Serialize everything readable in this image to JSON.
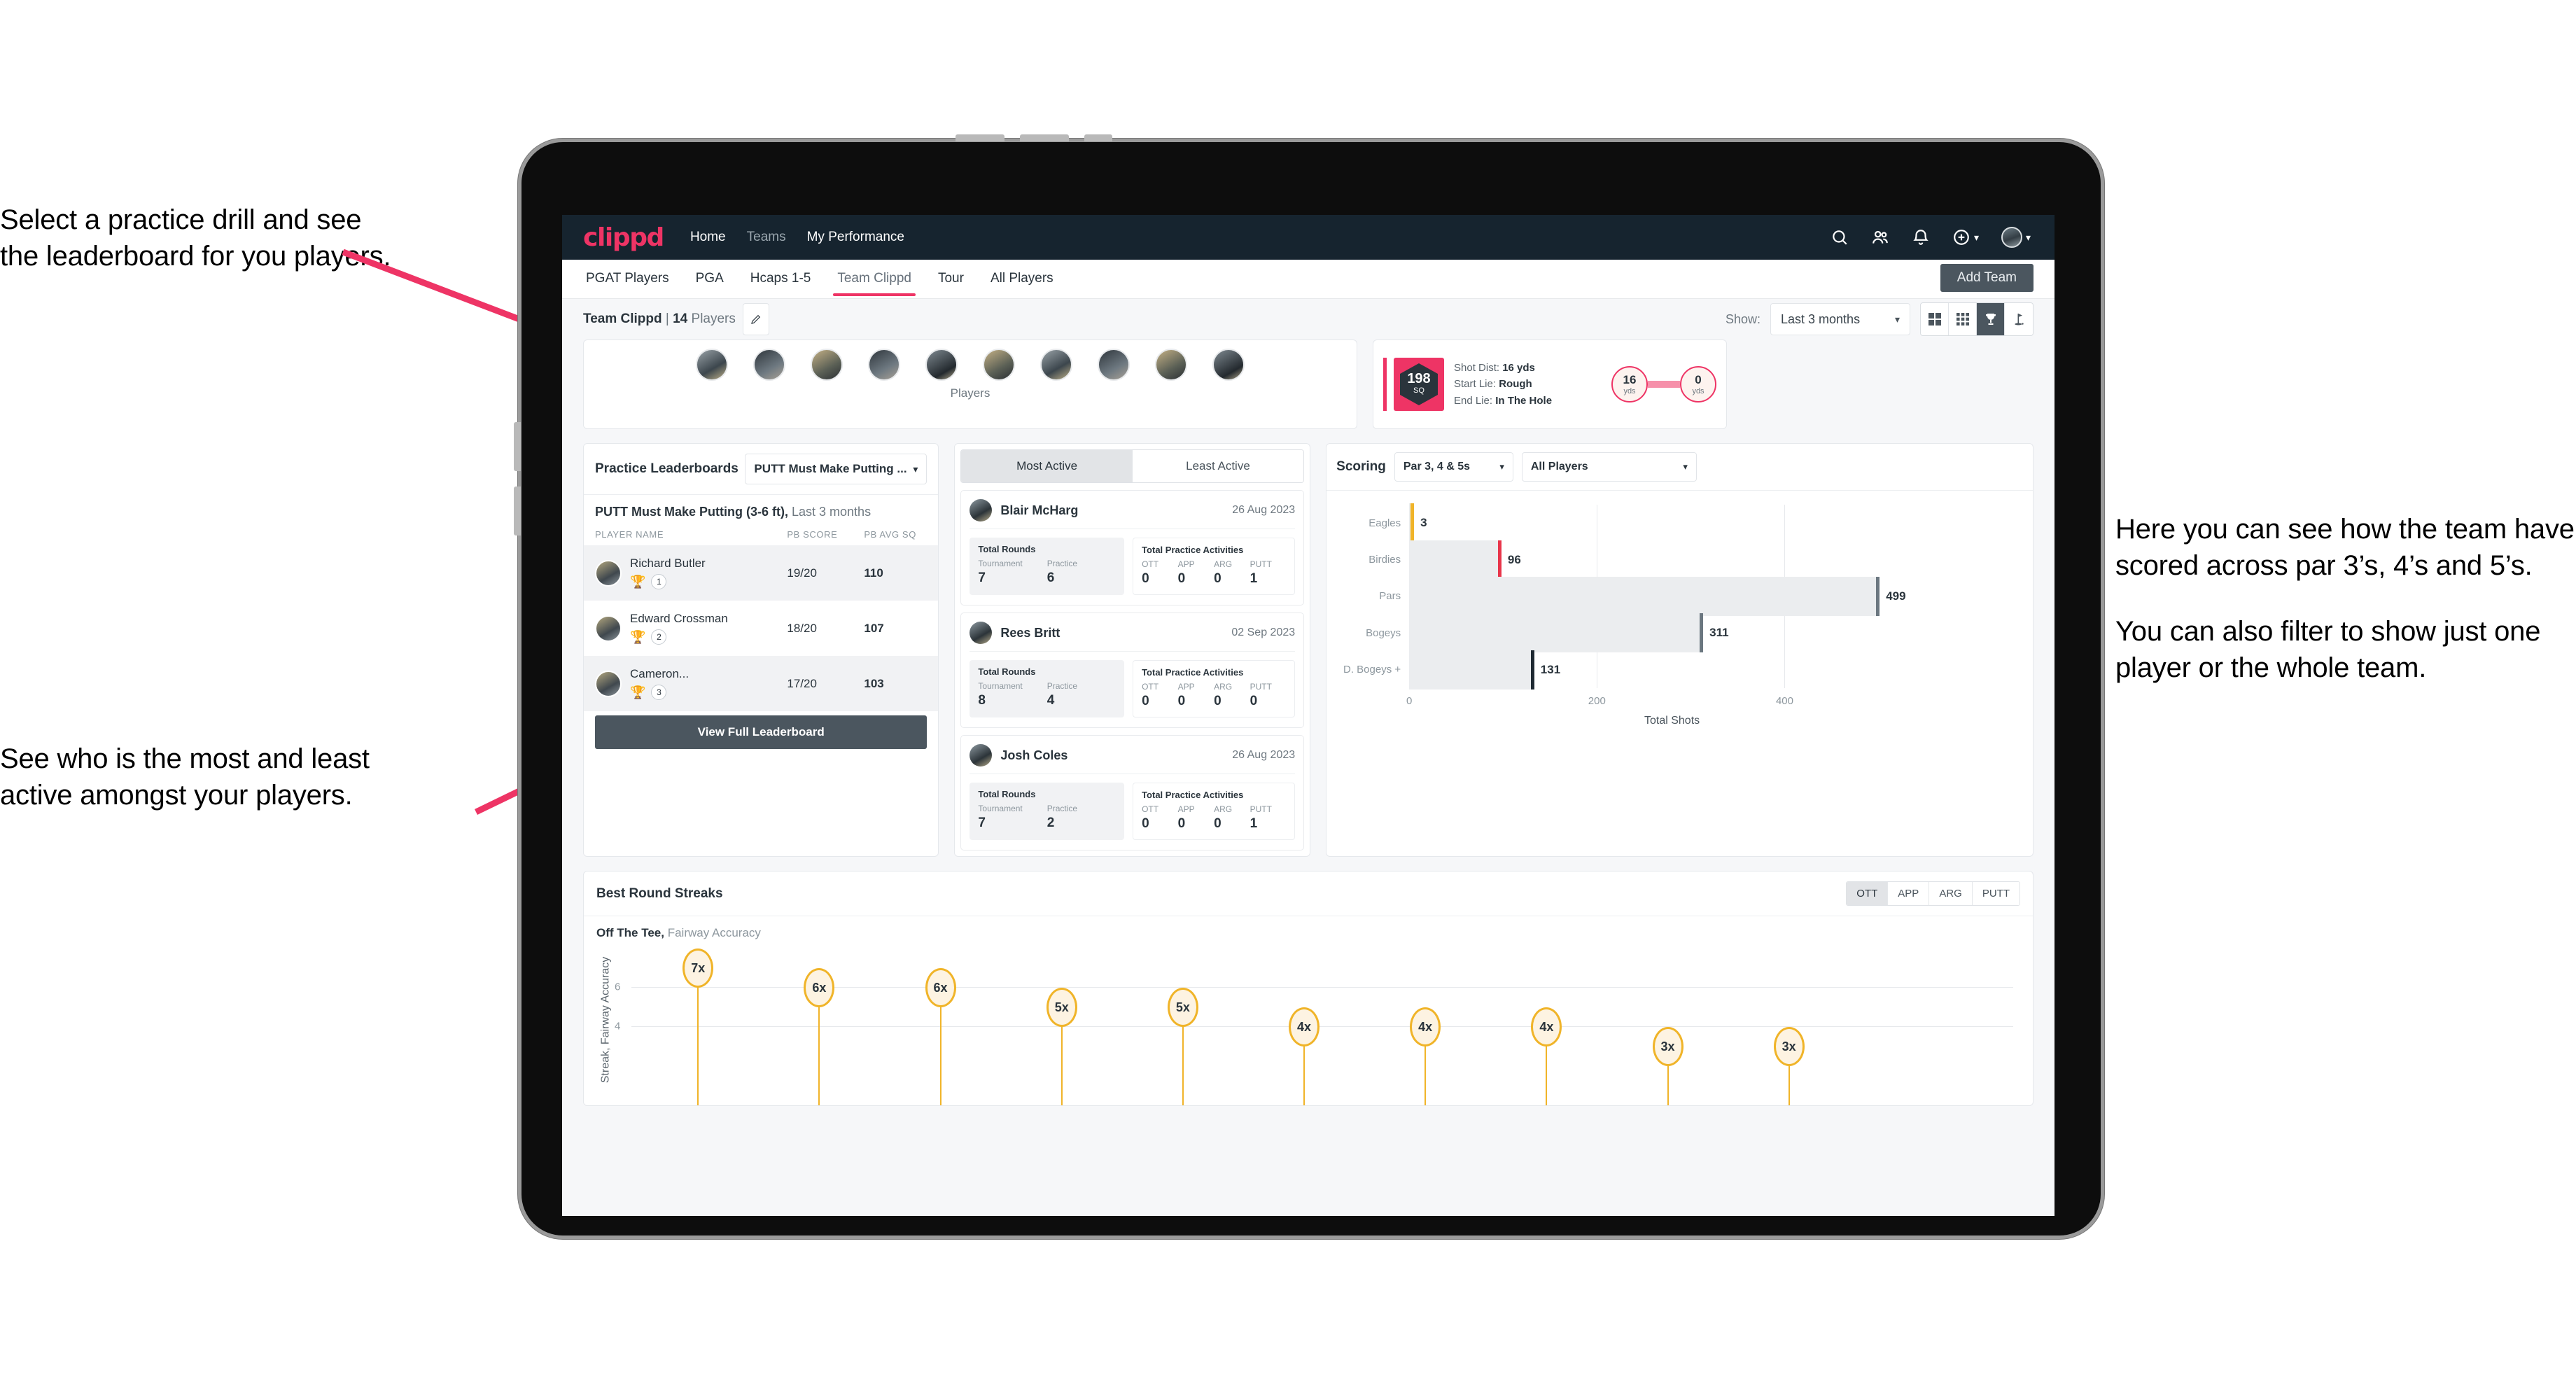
{
  "annotations": {
    "top_left": [
      "Select a practice drill and see",
      "the leaderboard for you players."
    ],
    "mid_left": [
      "See who is the most and least",
      "active amongst your players."
    ],
    "right": [
      "Here you can see how the team have scored across par 3’s, 4’s and 5’s.",
      "You can also filter to show just one player or the whole team."
    ]
  },
  "navbar": {
    "brand": "clippd",
    "links": [
      {
        "label": "Home",
        "dim": false
      },
      {
        "label": "Teams",
        "dim": true
      },
      {
        "label": "My Performance",
        "dim": false
      }
    ],
    "icons": [
      "search-icon",
      "people-icon",
      "bell-icon",
      "plus-circle-icon",
      "avatar"
    ]
  },
  "tabs": [
    {
      "label": "PGAT Players",
      "active": false
    },
    {
      "label": "PGA",
      "active": false
    },
    {
      "label": "Hcaps 1-5",
      "active": false
    },
    {
      "label": "Team Clippd",
      "active": true
    },
    {
      "label": "Tour",
      "active": false
    },
    {
      "label": "All Players",
      "active": false
    }
  ],
  "add_team_button": "Add Team",
  "subbar": {
    "team_name": "Team Clippd",
    "separator": " | ",
    "player_count": "14",
    "players_word": " Players",
    "edit_icon": "pencil-icon",
    "show_label": "Show:",
    "range_value": "Last 3 months",
    "view_toggles": [
      "grid-2x2-icon",
      "grid-3x3-icon",
      "trophy-icon",
      "flag-icon"
    ],
    "active_view": "trophy-icon"
  },
  "players_strip": {
    "caption": "Players",
    "avatar_count": 10
  },
  "shot_card": {
    "sq_value": "198",
    "sq_unit": "SQ",
    "lines": [
      {
        "label": "Shot Dist: ",
        "value": "16 yds"
      },
      {
        "label": "Start Lie: ",
        "value": "Rough"
      },
      {
        "label": "End Lie: ",
        "value": "In The Hole"
      }
    ],
    "start_node": {
      "value": "16",
      "unit": "yds"
    },
    "end_node": {
      "value": "0",
      "unit": "yds"
    }
  },
  "leaderboard": {
    "title": "Practice Leaderboards",
    "drill_select": "PUTT Must Make Putting ...",
    "subtitle_bold": "PUTT Must Make Putting (3-6 ft),",
    "subtitle_light": " Last 3 months",
    "columns": [
      "PLAYER NAME",
      "PB SCORE",
      "PB AVG SQ"
    ],
    "rows": [
      {
        "name": "Richard Butler",
        "rank": "1",
        "medal": "gold",
        "score": "19/20",
        "sq": "110"
      },
      {
        "name": "Edward Crossman",
        "rank": "2",
        "medal": "silver",
        "score": "18/20",
        "sq": "107"
      },
      {
        "name": "Cameron...",
        "rank": "3",
        "medal": "bronze",
        "score": "17/20",
        "sq": "103"
      }
    ],
    "button": "View Full Leaderboard"
  },
  "activity": {
    "tabs": [
      {
        "label": "Most Active",
        "active": true
      },
      {
        "label": "Least Active",
        "active": false
      }
    ],
    "rounds_title": "Total Rounds",
    "rounds_cols": [
      "Tournament",
      "Practice"
    ],
    "acts_title": "Total Practice Activities",
    "acts_cols": [
      "OTT",
      "APP",
      "ARG",
      "PUTT"
    ],
    "cards": [
      {
        "name": "Blair McHarg",
        "date": "26 Aug 2023",
        "rounds": [
          "7",
          "6"
        ],
        "acts": [
          "0",
          "0",
          "0",
          "1"
        ]
      },
      {
        "name": "Rees Britt",
        "date": "02 Sep 2023",
        "rounds": [
          "8",
          "4"
        ],
        "acts": [
          "0",
          "0",
          "0",
          "0"
        ]
      },
      {
        "name": "Josh Coles",
        "date": "26 Aug 2023",
        "rounds": [
          "7",
          "2"
        ],
        "acts": [
          "0",
          "0",
          "0",
          "1"
        ]
      }
    ]
  },
  "scoring": {
    "title": "Scoring",
    "par_select": "Par 3, 4 & 5s",
    "player_select": "All Players"
  },
  "streaks": {
    "title": "Best Round Streaks",
    "segments": [
      {
        "label": "OTT",
        "active": true
      },
      {
        "label": "APP",
        "active": false
      },
      {
        "label": "ARG",
        "active": false
      },
      {
        "label": "PUTT",
        "active": false
      }
    ],
    "sub_bold": "Off The Tee,",
    "sub_light": " Fairway Accuracy"
  },
  "chart_data": [
    {
      "type": "bar",
      "orientation": "horizontal",
      "title": "Scoring",
      "categories": [
        "Eagles",
        "Birdies",
        "Pars",
        "Bogeys",
        "D. Bogeys +"
      ],
      "values": [
        3,
        96,
        499,
        311,
        131
      ],
      "cap_colors": [
        "#f0b429",
        "#e8354a",
        "#6b7780",
        "#6b7780",
        "#1f2a33"
      ],
      "xlabel": "Total Shots",
      "ylabel": "",
      "xlim": [
        0,
        560
      ],
      "xticks": [
        0,
        200,
        400
      ],
      "grid": true,
      "legend": "none"
    },
    {
      "type": "bar",
      "orientation": "vertical",
      "title": "Best Round Streaks",
      "subtitle": "Off The Tee, Fairway Accuracy",
      "ylabel": "Streak, Fairway Accuracy",
      "categories": [
        "",
        "",
        "",
        "",
        "",
        "",
        "",
        "",
        "",
        ""
      ],
      "values": [
        7,
        6,
        6,
        5,
        5,
        4,
        4,
        4,
        3,
        3
      ],
      "labels": [
        "7x",
        "6x",
        "6x",
        "5x",
        "5x",
        "4x",
        "4x",
        "4x",
        "3x",
        "3x"
      ],
      "yticks": [
        4,
        6
      ],
      "ylim": [
        0,
        8
      ],
      "grid": true,
      "series_color": "#f0b429"
    }
  ]
}
